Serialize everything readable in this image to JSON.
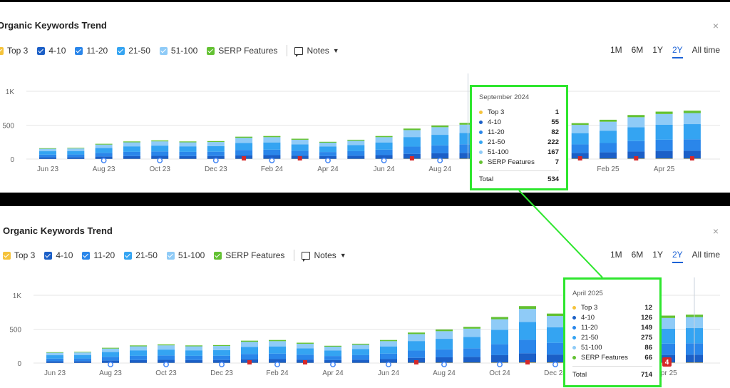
{
  "widget_title": "Organic Keywords Trend",
  "close_icon": "×",
  "legend": [
    {
      "label": "Top 3",
      "color": "#f5c33b"
    },
    {
      "label": "4-10",
      "color": "#1b5fc7"
    },
    {
      "label": "11-20",
      "color": "#2a86ea"
    },
    {
      "label": "21-50",
      "color": "#34a4f2"
    },
    {
      "label": "51-100",
      "color": "#8fcbf7"
    },
    {
      "label": "SERP Features",
      "color": "#63c132"
    }
  ],
  "notes_label": "Notes",
  "ranges": [
    "1M",
    "6M",
    "1Y",
    "2Y",
    "All time"
  ],
  "active_range": "2Y",
  "tooltip_top": {
    "date": "September 2024",
    "rows": [
      {
        "label": "Top 3",
        "value": "1",
        "color": "#f5c33b"
      },
      {
        "label": "4-10",
        "value": "55",
        "color": "#1b5fc7"
      },
      {
        "label": "11-20",
        "value": "82",
        "color": "#2a86ea"
      },
      {
        "label": "21-50",
        "value": "222",
        "color": "#34a4f2"
      },
      {
        "label": "51-100",
        "value": "167",
        "color": "#8fcbf7"
      },
      {
        "label": "SERP Features",
        "value": "7",
        "color": "#63c132"
      }
    ],
    "total_label": "Total",
    "total_value": "534"
  },
  "tooltip_bottom": {
    "date": "April 2025",
    "rows": [
      {
        "label": "Top 3",
        "value": "12",
        "color": "#f5c33b"
      },
      {
        "label": "4-10",
        "value": "126",
        "color": "#1b5fc7"
      },
      {
        "label": "11-20",
        "value": "149",
        "color": "#2a86ea"
      },
      {
        "label": "21-50",
        "value": "275",
        "color": "#34a4f2"
      },
      {
        "label": "51-100",
        "value": "86",
        "color": "#8fcbf7"
      },
      {
        "label": "SERP Features",
        "value": "66",
        "color": "#63c132"
      }
    ],
    "total_label": "Total",
    "total_value": "714"
  },
  "chart_data": [
    {
      "type": "bar",
      "x_tick_labels": [
        "Jun 23",
        "Aug 23",
        "Oct 23",
        "Dec 23",
        "Feb 24",
        "Apr 24",
        "Jun 24",
        "Aug 24",
        "Oct 24",
        "Dec 24",
        "Feb 25",
        "Apr 25"
      ],
      "y_tick_labels": [
        "0",
        "500",
        "1K"
      ],
      "ylim": [
        0,
        1000
      ],
      "stacked": true,
      "series_names": [
        "Top 3",
        "4-10",
        "11-20",
        "21-50",
        "51-100",
        "SERP Features"
      ],
      "totals": [
        160,
        165,
        225,
        260,
        275,
        260,
        265,
        330,
        340,
        300,
        255,
        285,
        340,
        450,
        495,
        534,
        0,
        0,
        0,
        530,
        580,
        650,
        700,
        714
      ],
      "hidden_columns": [
        16,
        17,
        18
      ],
      "annotation_columns": [
        2,
        4,
        6,
        8,
        10,
        12,
        14,
        16
      ],
      "flag_columns": [
        7,
        9,
        13,
        17,
        19,
        21,
        23
      ],
      "selected_column": 15
    },
    {
      "type": "bar",
      "x_tick_labels": [
        "Jun 23",
        "Aug 23",
        "Oct 23",
        "Dec 23",
        "Feb 24",
        "Apr 24",
        "Jun 24",
        "Aug 24",
        "Oct 24",
        "Dec 24",
        "Feb 25",
        "Apr 25"
      ],
      "y_tick_labels": [
        "0",
        "500",
        "1K"
      ],
      "ylim": [
        0,
        1000
      ],
      "stacked": true,
      "series_names": [
        "Top 3",
        "4-10",
        "11-20",
        "21-50",
        "51-100",
        "SERP Features"
      ],
      "totals": [
        160,
        165,
        225,
        260,
        275,
        260,
        265,
        330,
        340,
        300,
        255,
        285,
        340,
        450,
        495,
        534,
        680,
        840,
        730,
        0,
        0,
        0,
        700,
        714
      ],
      "hidden_columns": [
        19,
        20,
        21
      ],
      "annotation_columns": [
        2,
        4,
        6,
        8,
        10,
        12,
        14,
        16,
        18
      ],
      "flag_columns": [
        7,
        9,
        13,
        17,
        19
      ],
      "selected_column": 23,
      "alert_badge": "4"
    }
  ]
}
